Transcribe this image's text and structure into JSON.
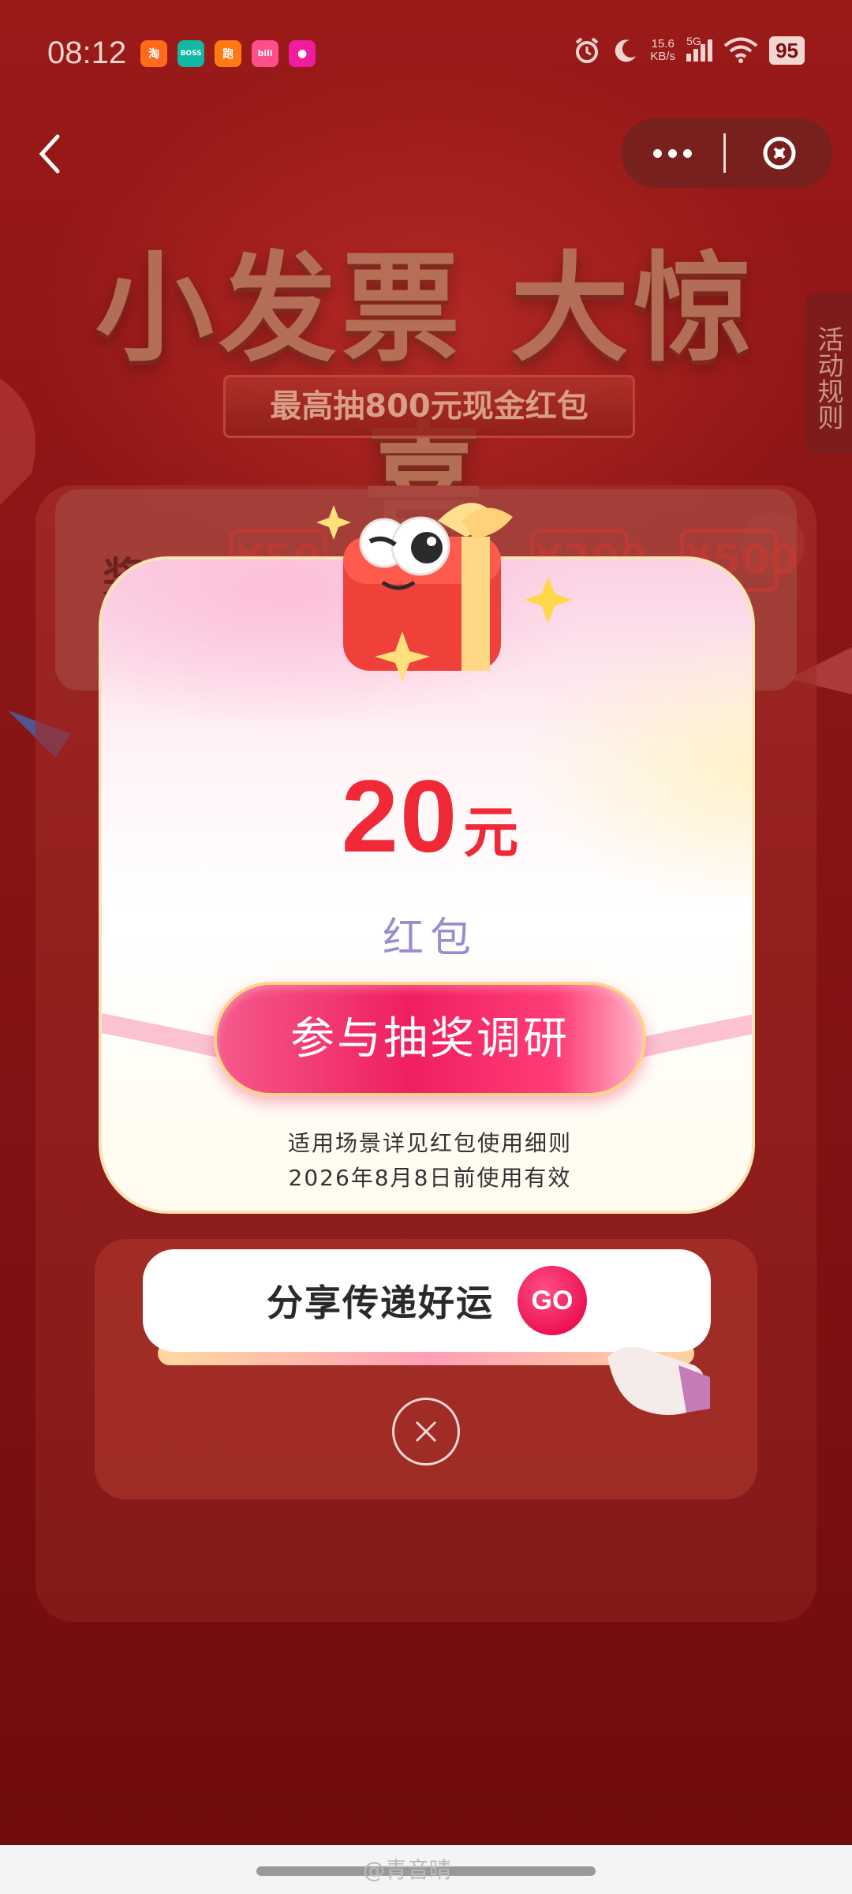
{
  "status_bar": {
    "time": "08:12",
    "apps": [
      {
        "name": "taobao",
        "label": "淘",
        "color": "#ff6a1a"
      },
      {
        "name": "boss",
        "label": "BOSS",
        "color": "#12b8a6"
      },
      {
        "name": "keep",
        "label": "跑",
        "color": "#ff7a12"
      },
      {
        "name": "bilibili",
        "label": "bili",
        "color": "#ff4f8a"
      },
      {
        "name": "app5",
        "label": "●",
        "color": "#f01ca0"
      }
    ],
    "net_speed_value": "15.6",
    "net_speed_unit": "KB/s",
    "signal_label": "5G",
    "battery": "95"
  },
  "header": {
    "back_icon": "chevron-left-icon",
    "more_icon": "more-dots-icon",
    "close_icon": "close-circle-icon"
  },
  "banner": {
    "title": "小发票 大惊喜",
    "subtitle": "最高抽800元现金红包"
  },
  "rules_tab": "活动规则",
  "background_panel": {
    "label": "奖品",
    "chips": [
      "¥50",
      "¥300",
      "¥500"
    ]
  },
  "modal": {
    "amount": "20",
    "unit": "元",
    "prize_type": "红包",
    "survey_button": "参与抽奖调研",
    "note_line1": "适用场景详见红包使用细则",
    "note_line2": "2026年8月8日前使用有效"
  },
  "share": {
    "label": "分享传递好运",
    "go": "GO"
  },
  "watermark": "@青音晴",
  "colors": {
    "accent_red": "#ef2a36",
    "button_pink": "#ef1f60",
    "background": "#8a1515"
  }
}
